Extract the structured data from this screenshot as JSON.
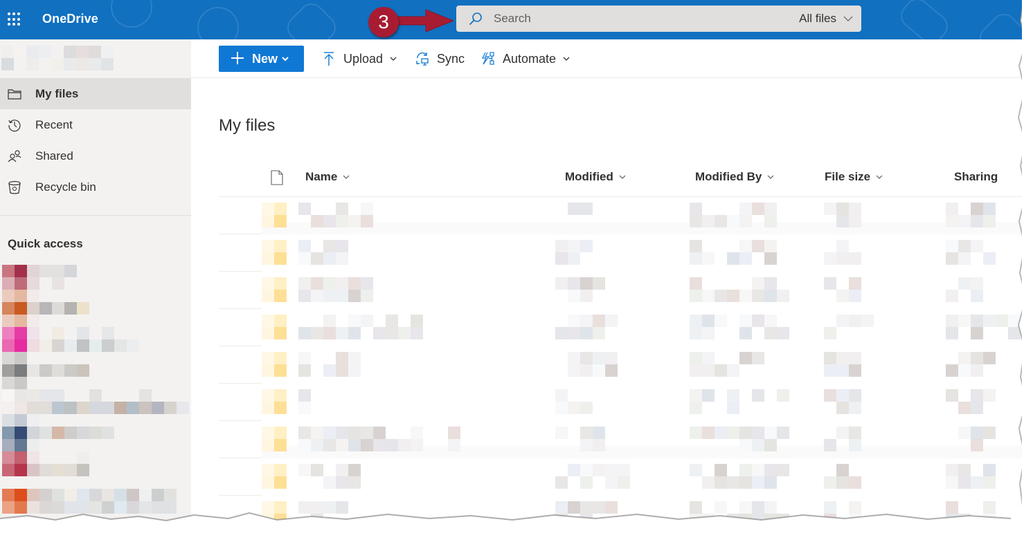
{
  "app": {
    "brand": "OneDrive",
    "brand_color": "#1170c0",
    "accent_color": "#0f78d4",
    "annotation_color": "#a81c32"
  },
  "annotation": {
    "step_number": "3"
  },
  "search": {
    "placeholder": "Search",
    "value": "",
    "scope_label": "All files"
  },
  "sidebar": {
    "items": [
      {
        "label": "My files",
        "icon": "folder-icon",
        "active": true
      },
      {
        "label": "Recent",
        "icon": "history-icon",
        "active": false
      },
      {
        "label": "Shared",
        "icon": "people-icon",
        "active": false
      },
      {
        "label": "Recycle bin",
        "icon": "recycle-bin-icon",
        "active": false
      }
    ],
    "quick_access_title": "Quick access",
    "account_name_redacted": true
  },
  "commands": {
    "new_label": "New",
    "upload_label": "Upload",
    "sync_label": "Sync",
    "automate_label": "Automate"
  },
  "page": {
    "title": "My files"
  },
  "table": {
    "columns": [
      {
        "key": "name",
        "label": "Name",
        "sortable": true
      },
      {
        "key": "modified",
        "label": "Modified",
        "sortable": true
      },
      {
        "key": "modified_by",
        "label": "Modified By",
        "sortable": true
      },
      {
        "key": "file_size",
        "label": "File size",
        "sortable": true
      },
      {
        "key": "sharing",
        "label": "Sharing",
        "sortable": false
      }
    ],
    "rows_redacted": true,
    "row_count_visible": 9,
    "row_type": "folder"
  }
}
